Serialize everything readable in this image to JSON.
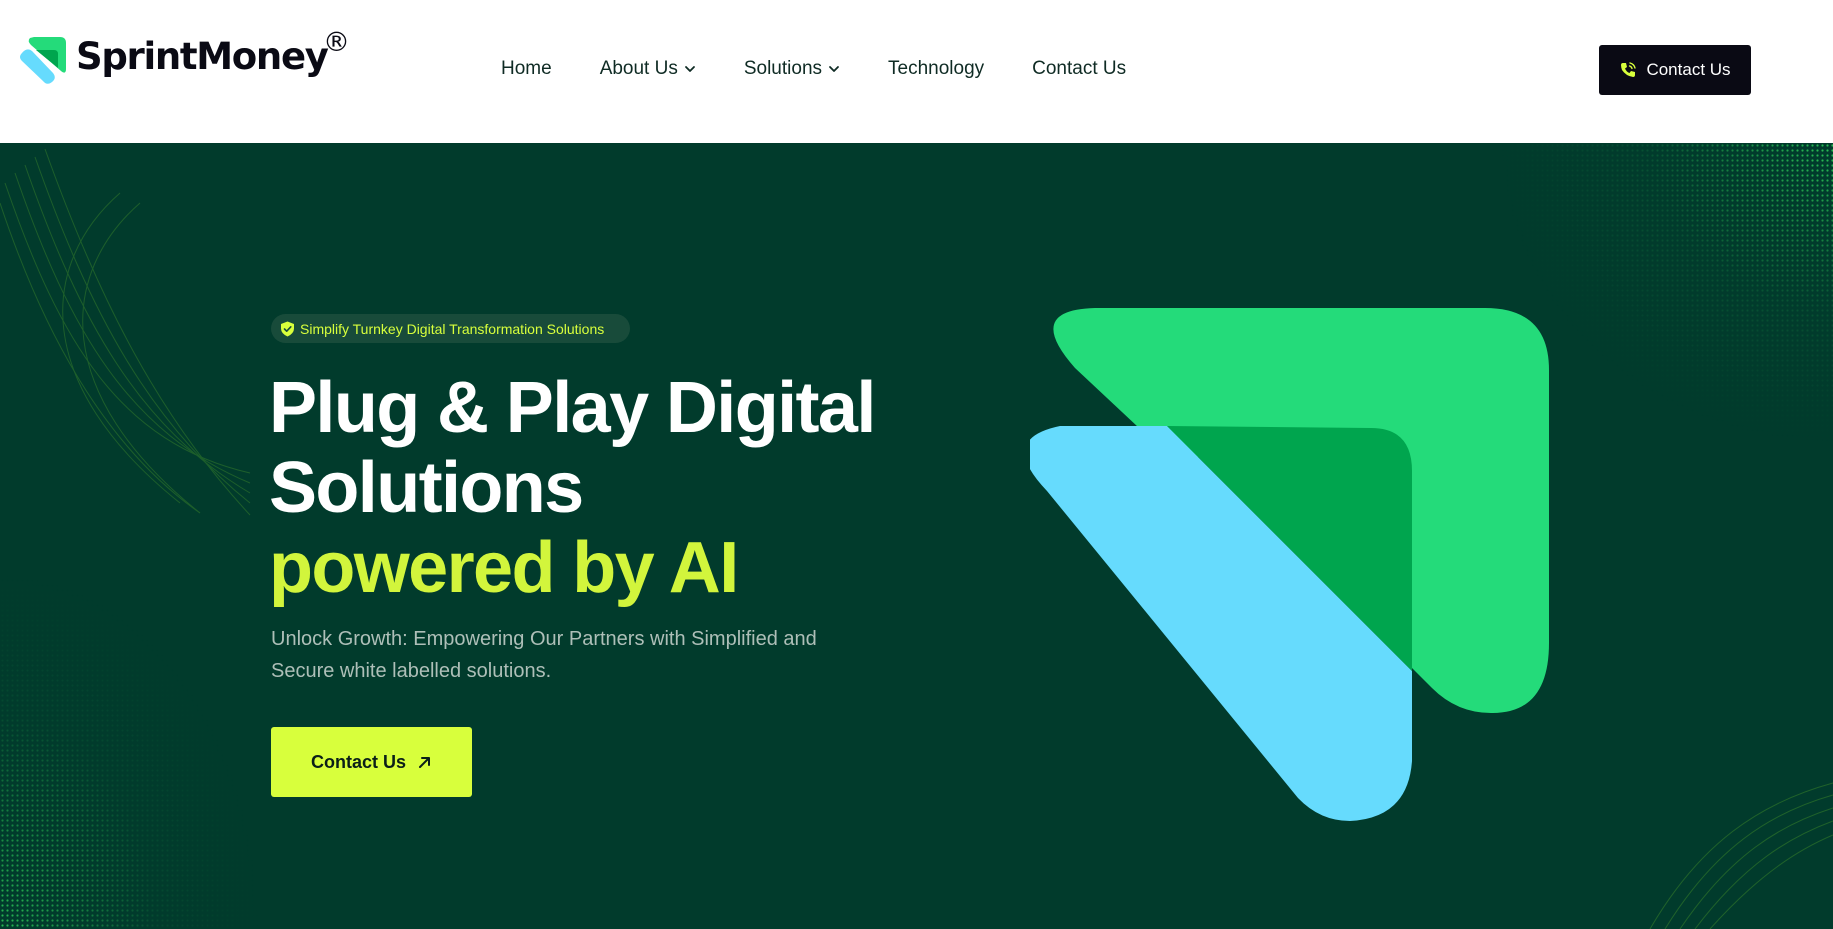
{
  "header": {
    "logo": {
      "name": "SprintMoney",
      "registered": "®"
    },
    "nav": [
      {
        "label": "Home",
        "has_dropdown": false
      },
      {
        "label": "About Us",
        "has_dropdown": true
      },
      {
        "label": "Solutions",
        "has_dropdown": true
      },
      {
        "label": "Technology",
        "has_dropdown": false
      },
      {
        "label": "Contact Us",
        "has_dropdown": false
      }
    ],
    "cta": {
      "label": "Contact Us",
      "icon": "phone-icon"
    }
  },
  "hero": {
    "badge": {
      "text": "Simplify Turnkey Digital Transformation Solutions",
      "icon": "shield-check-icon"
    },
    "title_line1": "Plug & Play Digital",
    "title_line2": "Solutions",
    "title_accent": "powered by AI",
    "subtitle": "Unlock Growth: Empowering Our Partners with Simplified and Secure white labelled solutions.",
    "cta": {
      "label": "Contact Us",
      "icon": "arrow-up-right-icon"
    }
  },
  "colors": {
    "hero_bg": "#013b2c",
    "accent_lime": "#d8ff3c",
    "brand_green": "#24db7a",
    "brand_dark_green": "#00a54e",
    "brand_cyan": "#66dbfd",
    "dark": "#0a0a14"
  }
}
